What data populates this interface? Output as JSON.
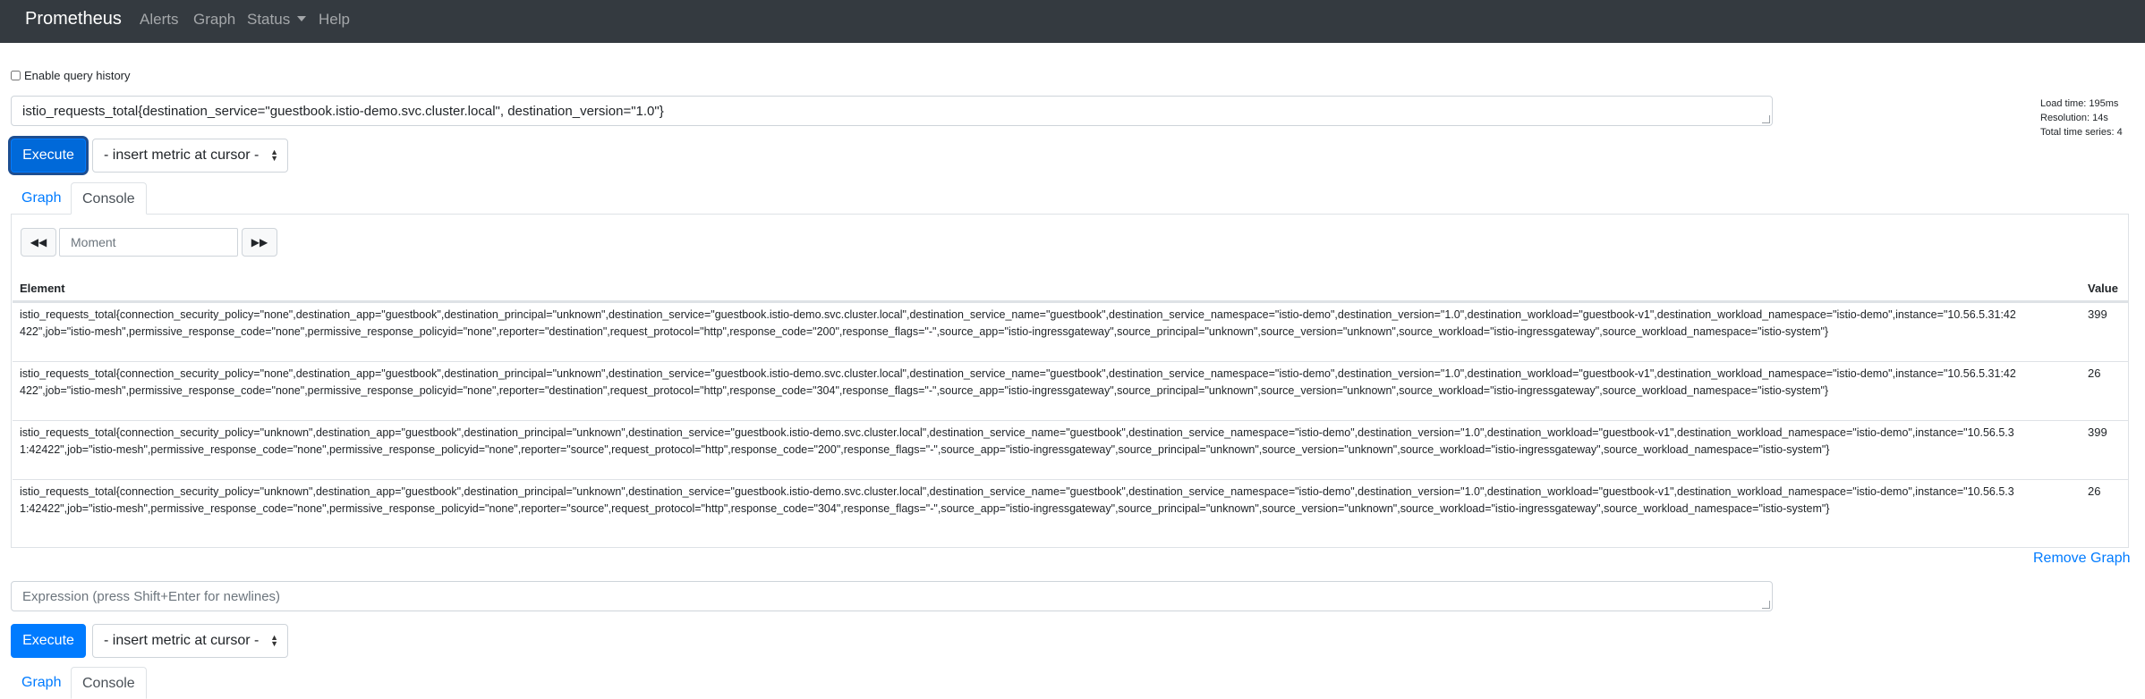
{
  "navbar": {
    "brand": "Prometheus",
    "items": [
      "Alerts",
      "Graph",
      "Status",
      "Help"
    ]
  },
  "history": {
    "label": "Enable query history",
    "checked": false
  },
  "panel1": {
    "expression": "istio_requests_total{destination_service=\"guestbook.istio-demo.svc.cluster.local\", destination_version=\"1.0\"}",
    "stats": {
      "load_time": "Load time: 195ms",
      "resolution": "Resolution: 14s",
      "total_series": "Total time series: 4"
    },
    "execute_label": "Execute",
    "metric_select": "- insert metric at cursor -",
    "tabs": [
      "Graph",
      "Console"
    ],
    "active_tab": "Console",
    "moment_placeholder": "Moment",
    "table": {
      "headers": [
        "Element",
        "Value"
      ],
      "rows": [
        {
          "element": "istio_requests_total{connection_security_policy=\"none\",destination_app=\"guestbook\",destination_principal=\"unknown\",destination_service=\"guestbook.istio-demo.svc.cluster.local\",destination_service_name=\"guestbook\",destination_service_namespace=\"istio-demo\",destination_version=\"1.0\",destination_workload=\"guestbook-v1\",destination_workload_namespace=\"istio-demo\",instance=\"10.56.5.31:42422\",job=\"istio-mesh\",permissive_response_code=\"none\",permissive_response_policyid=\"none\",reporter=\"destination\",request_protocol=\"http\",response_code=\"200\",response_flags=\"-\",source_app=\"istio-ingressgateway\",source_principal=\"unknown\",source_version=\"unknown\",source_workload=\"istio-ingressgateway\",source_workload_namespace=\"istio-system\"}",
          "value": "399"
        },
        {
          "element": "istio_requests_total{connection_security_policy=\"none\",destination_app=\"guestbook\",destination_principal=\"unknown\",destination_service=\"guestbook.istio-demo.svc.cluster.local\",destination_service_name=\"guestbook\",destination_service_namespace=\"istio-demo\",destination_version=\"1.0\",destination_workload=\"guestbook-v1\",destination_workload_namespace=\"istio-demo\",instance=\"10.56.5.31:42422\",job=\"istio-mesh\",permissive_response_code=\"none\",permissive_response_policyid=\"none\",reporter=\"destination\",request_protocol=\"http\",response_code=\"304\",response_flags=\"-\",source_app=\"istio-ingressgateway\",source_principal=\"unknown\",source_version=\"unknown\",source_workload=\"istio-ingressgateway\",source_workload_namespace=\"istio-system\"}",
          "value": "26"
        },
        {
          "element": "istio_requests_total{connection_security_policy=\"unknown\",destination_app=\"guestbook\",destination_principal=\"unknown\",destination_service=\"guestbook.istio-demo.svc.cluster.local\",destination_service_name=\"guestbook\",destination_service_namespace=\"istio-demo\",destination_version=\"1.0\",destination_workload=\"guestbook-v1\",destination_workload_namespace=\"istio-demo\",instance=\"10.56.5.31:42422\",job=\"istio-mesh\",permissive_response_code=\"none\",permissive_response_policyid=\"none\",reporter=\"source\",request_protocol=\"http\",response_code=\"200\",response_flags=\"-\",source_app=\"istio-ingressgateway\",source_principal=\"unknown\",source_version=\"unknown\",source_workload=\"istio-ingressgateway\",source_workload_namespace=\"istio-system\"}",
          "value": "399"
        },
        {
          "element": "istio_requests_total{connection_security_policy=\"unknown\",destination_app=\"guestbook\",destination_principal=\"unknown\",destination_service=\"guestbook.istio-demo.svc.cluster.local\",destination_service_name=\"guestbook\",destination_service_namespace=\"istio-demo\",destination_version=\"1.0\",destination_workload=\"guestbook-v1\",destination_workload_namespace=\"istio-demo\",instance=\"10.56.5.31:42422\",job=\"istio-mesh\",permissive_response_code=\"none\",permissive_response_policyid=\"none\",reporter=\"source\",request_protocol=\"http\",response_code=\"304\",response_flags=\"-\",source_app=\"istio-ingressgateway\",source_principal=\"unknown\",source_version=\"unknown\",source_workload=\"istio-ingressgateway\",source_workload_namespace=\"istio-system\"}",
          "value": "26"
        }
      ]
    },
    "remove_label": "Remove Graph"
  },
  "panel2": {
    "placeholder": "Expression (press Shift+Enter for newlines)",
    "execute_label": "Execute",
    "metric_select": "- insert metric at cursor -",
    "tabs": [
      "Graph",
      "Console"
    ]
  },
  "colors": {
    "navbar_bg": "#343a40",
    "primary": "#007bff"
  },
  "icons": [
    "backward-icon",
    "forward-icon",
    "caret-down-icon",
    "select-arrows-icon"
  ]
}
